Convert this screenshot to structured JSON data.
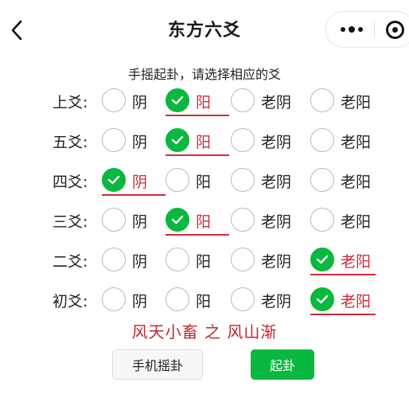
{
  "navbar": {
    "title": "东方六爻",
    "back_icon": "chevron-left-icon",
    "more_icon": "more-dots-icon",
    "close_icon": "miniprogram-close-icon"
  },
  "instruction": "手摇起卦，请选择相应的爻",
  "option_labels": [
    "阴",
    "阳",
    "老阴",
    "老阳"
  ],
  "yao_rows": [
    {
      "label": "上爻:",
      "selected": "阳"
    },
    {
      "label": "五爻:",
      "selected": "阳"
    },
    {
      "label": "四爻:",
      "selected": "阴"
    },
    {
      "label": "三爻:",
      "selected": "阳"
    },
    {
      "label": "二爻:",
      "selected": "老阳"
    },
    {
      "label": "初爻:",
      "selected": "老阳"
    }
  ],
  "result": "风天小畜 之 风山渐",
  "buttons": {
    "phone_shake": "手机摇卦",
    "start": "起卦"
  },
  "colors": {
    "accent_green": "#09b83e",
    "selected_red": "#d4283a",
    "result_red": "#c0272d"
  }
}
